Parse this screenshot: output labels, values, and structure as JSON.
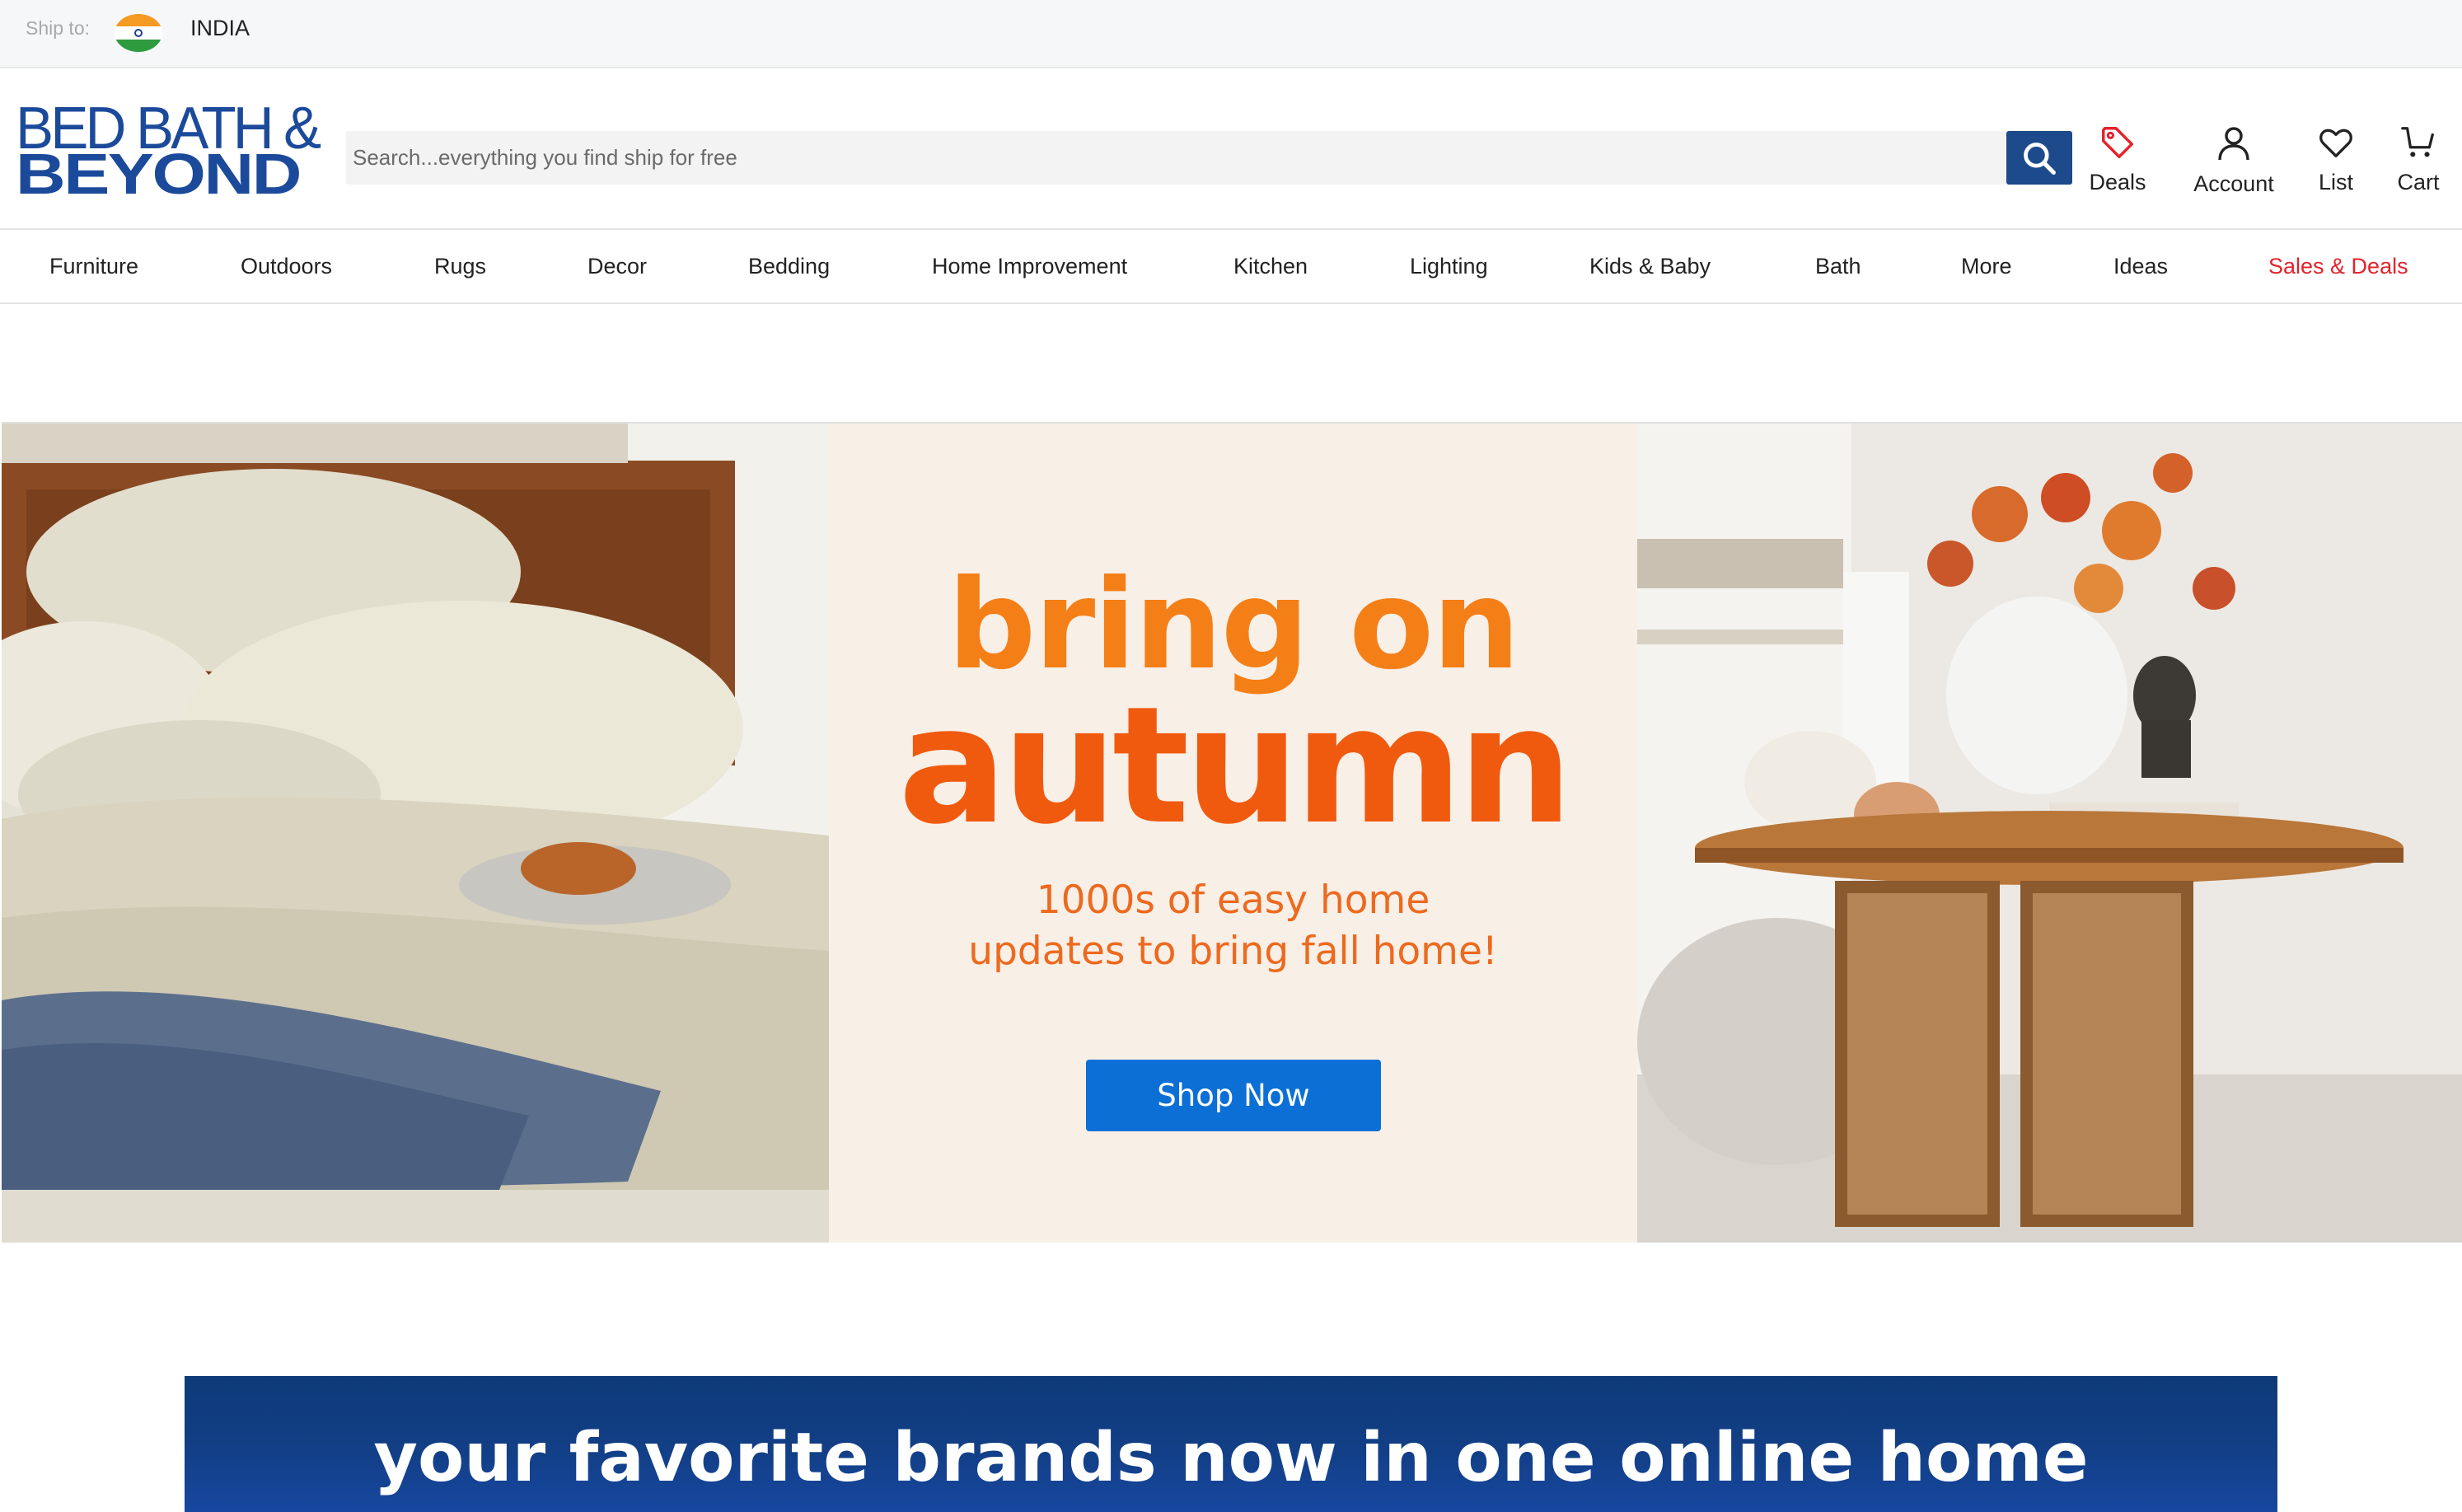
{
  "ship_bar": {
    "label": "Ship to:",
    "flag_icon": "india-flag-icon",
    "country": "INDIA"
  },
  "header": {
    "logo_line1": "BED BATH &",
    "logo_line2": "BEYOND",
    "brand_color": "#1c4a9b",
    "search": {
      "placeholder": "Search...everything you find ship for free",
      "value": "",
      "button_icon": "search-icon",
      "button_color": "#1c4a8a"
    },
    "actions": [
      {
        "label": "Deals",
        "icon": "tag-icon",
        "icon_color": "#e4222b"
      },
      {
        "label": "Account",
        "icon": "user-icon"
      },
      {
        "label": "List",
        "icon": "heart-icon"
      },
      {
        "label": "Cart",
        "icon": "cart-icon"
      }
    ]
  },
  "nav": {
    "items": [
      "Furniture",
      "Outdoors",
      "Rugs",
      "Decor",
      "Bedding",
      "Home Improvement",
      "Kitchen",
      "Lighting",
      "Kids & Baby",
      "Bath",
      "More",
      "Ideas",
      "Sales & Deals"
    ],
    "highlight_color": "#e4222b"
  },
  "hero": {
    "title_line1": "bring on",
    "title_line2": "autumn",
    "subtitle_line1": "1000s of easy home",
    "subtitle_line2": "updates to bring fall home!",
    "cta": "Shop Now",
    "cta_color": "#0b6fd6",
    "accent_color": "#f57f17"
  },
  "brands_banner": {
    "text": "your favorite brands now in one online home",
    "background": "#123f86"
  }
}
